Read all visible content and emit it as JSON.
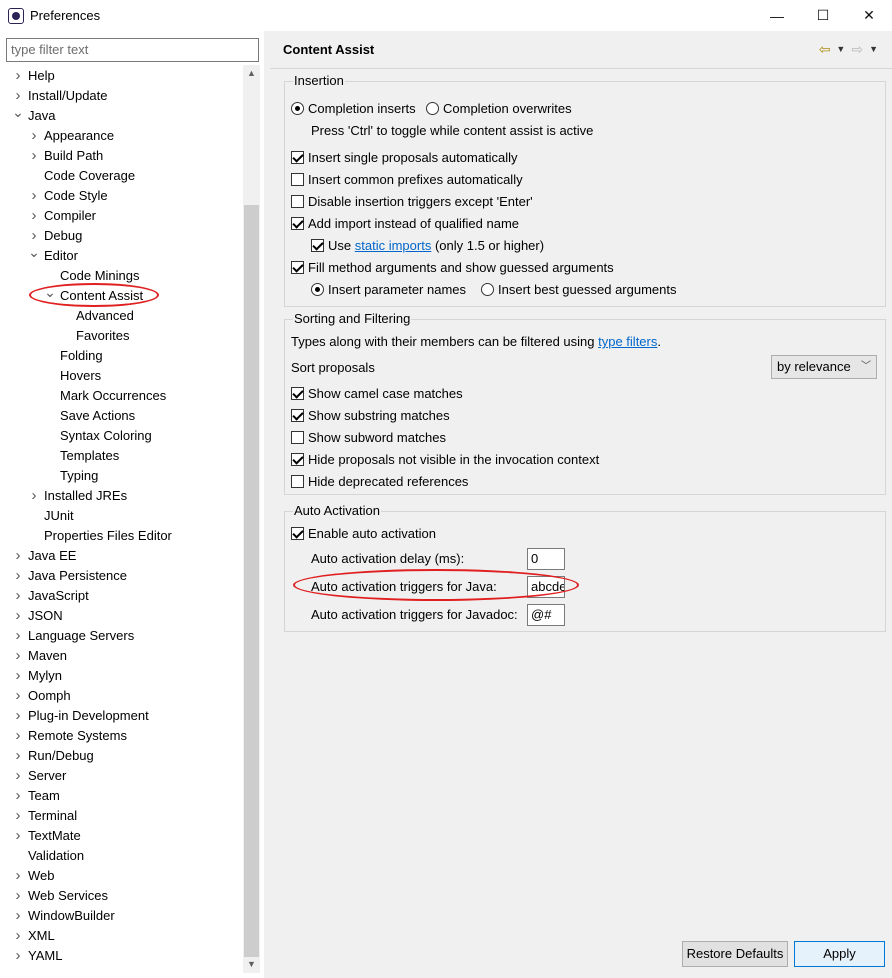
{
  "window": {
    "title": "Preferences",
    "minimize_glyph": "—",
    "maximize_glyph": "☐",
    "close_glyph": "✕"
  },
  "filter": {
    "placeholder": "type filter text"
  },
  "tree": [
    {
      "label": "Help",
      "depth": 0,
      "twisty": "collapsed"
    },
    {
      "label": "Install/Update",
      "depth": 0,
      "twisty": "collapsed"
    },
    {
      "label": "Java",
      "depth": 0,
      "twisty": "expanded"
    },
    {
      "label": "Appearance",
      "depth": 1,
      "twisty": "collapsed"
    },
    {
      "label": "Build Path",
      "depth": 1,
      "twisty": "collapsed"
    },
    {
      "label": "Code Coverage",
      "depth": 1,
      "twisty": "none"
    },
    {
      "label": "Code Style",
      "depth": 1,
      "twisty": "collapsed"
    },
    {
      "label": "Compiler",
      "depth": 1,
      "twisty": "collapsed"
    },
    {
      "label": "Debug",
      "depth": 1,
      "twisty": "collapsed"
    },
    {
      "label": "Editor",
      "depth": 1,
      "twisty": "expanded"
    },
    {
      "label": "Code Minings",
      "depth": 2,
      "twisty": "none"
    },
    {
      "label": "Content Assist",
      "depth": 2,
      "twisty": "expanded",
      "selected": true
    },
    {
      "label": "Advanced",
      "depth": 3,
      "twisty": "none"
    },
    {
      "label": "Favorites",
      "depth": 3,
      "twisty": "none"
    },
    {
      "label": "Folding",
      "depth": 2,
      "twisty": "none"
    },
    {
      "label": "Hovers",
      "depth": 2,
      "twisty": "none"
    },
    {
      "label": "Mark Occurrences",
      "depth": 2,
      "twisty": "none"
    },
    {
      "label": "Save Actions",
      "depth": 2,
      "twisty": "none"
    },
    {
      "label": "Syntax Coloring",
      "depth": 2,
      "twisty": "none"
    },
    {
      "label": "Templates",
      "depth": 2,
      "twisty": "none"
    },
    {
      "label": "Typing",
      "depth": 2,
      "twisty": "none"
    },
    {
      "label": "Installed JREs",
      "depth": 1,
      "twisty": "collapsed"
    },
    {
      "label": "JUnit",
      "depth": 1,
      "twisty": "none"
    },
    {
      "label": "Properties Files Editor",
      "depth": 1,
      "twisty": "none"
    },
    {
      "label": "Java EE",
      "depth": 0,
      "twisty": "collapsed"
    },
    {
      "label": "Java Persistence",
      "depth": 0,
      "twisty": "collapsed"
    },
    {
      "label": "JavaScript",
      "depth": 0,
      "twisty": "collapsed"
    },
    {
      "label": "JSON",
      "depth": 0,
      "twisty": "collapsed"
    },
    {
      "label": "Language Servers",
      "depth": 0,
      "twisty": "collapsed"
    },
    {
      "label": "Maven",
      "depth": 0,
      "twisty": "collapsed"
    },
    {
      "label": "Mylyn",
      "depth": 0,
      "twisty": "collapsed"
    },
    {
      "label": "Oomph",
      "depth": 0,
      "twisty": "collapsed"
    },
    {
      "label": "Plug-in Development",
      "depth": 0,
      "twisty": "collapsed"
    },
    {
      "label": "Remote Systems",
      "depth": 0,
      "twisty": "collapsed"
    },
    {
      "label": "Run/Debug",
      "depth": 0,
      "twisty": "collapsed"
    },
    {
      "label": "Server",
      "depth": 0,
      "twisty": "collapsed"
    },
    {
      "label": "Team",
      "depth": 0,
      "twisty": "collapsed"
    },
    {
      "label": "Terminal",
      "depth": 0,
      "twisty": "collapsed"
    },
    {
      "label": "TextMate",
      "depth": 0,
      "twisty": "collapsed"
    },
    {
      "label": "Validation",
      "depth": 0,
      "twisty": "none"
    },
    {
      "label": "Web",
      "depth": 0,
      "twisty": "collapsed"
    },
    {
      "label": "Web Services",
      "depth": 0,
      "twisty": "collapsed"
    },
    {
      "label": "WindowBuilder",
      "depth": 0,
      "twisty": "collapsed"
    },
    {
      "label": "XML",
      "depth": 0,
      "twisty": "collapsed"
    },
    {
      "label": "YAML",
      "depth": 0,
      "twisty": "collapsed"
    }
  ],
  "page": {
    "title": "Content Assist",
    "insertion": {
      "title": "Insertion",
      "completion_inserts": "Completion inserts",
      "completion_overwrites": "Completion overwrites",
      "toggle_hint": "Press 'Ctrl' to toggle while content assist is active",
      "insert_single": "Insert single proposals automatically",
      "insert_common": "Insert common prefixes automatically",
      "disable_triggers": "Disable insertion triggers except 'Enter'",
      "add_import": "Add import instead of qualified name",
      "use": "Use",
      "static_imports": "static imports",
      "only_15": "(only 1.5 or higher)",
      "fill_args": "Fill method arguments and show guessed arguments",
      "insert_param_names": "Insert parameter names",
      "insert_best_guessed": "Insert best guessed arguments"
    },
    "sorting": {
      "title": "Sorting and Filtering",
      "types_along": "Types along with their members can be filtered using",
      "type_filters": "type filters",
      "period": ".",
      "sort_proposals": "Sort proposals",
      "sort_value": "by relevance",
      "camel_case": "Show camel case matches",
      "substring": "Show substring matches",
      "subword": "Show subword matches",
      "hide_not_visible": "Hide proposals not visible in the invocation context",
      "hide_deprecated": "Hide deprecated references"
    },
    "auto": {
      "title": "Auto Activation",
      "enable": "Enable auto activation",
      "delay_label": "Auto activation delay (ms):",
      "delay_value": "0",
      "java_label": "Auto activation triggers for Java:",
      "java_value": "abcdefghijklmnopqrstuvwxyz.",
      "javadoc_label": "Auto activation triggers for Javadoc:",
      "javadoc_value": "@#"
    }
  },
  "buttons": {
    "restore_defaults": "Restore Defaults",
    "apply": "Apply"
  },
  "accent_colors": {
    "link": "#0066cc",
    "annotation": "#e02020",
    "default_button_border": "#0078d7"
  }
}
